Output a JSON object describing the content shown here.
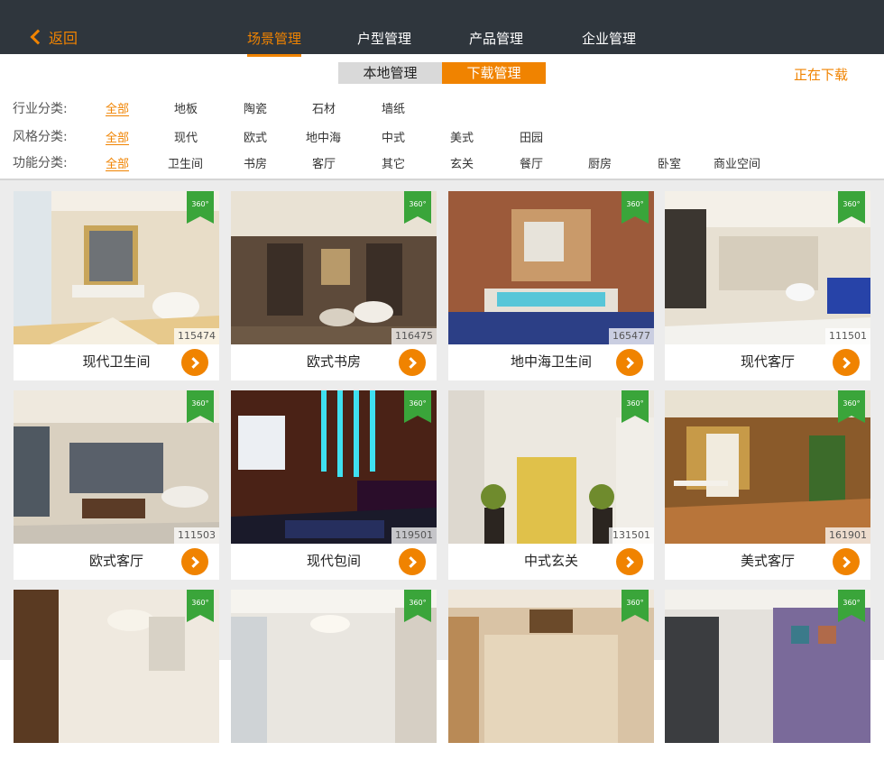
{
  "topbar": {
    "back_label": "返回",
    "tabs": [
      {
        "label": "场景管理",
        "active": true
      },
      {
        "label": "户型管理",
        "active": false
      },
      {
        "label": "产品管理",
        "active": false
      },
      {
        "label": "企业管理",
        "active": false
      }
    ]
  },
  "segment": {
    "local": "本地管理",
    "download": "下载管理",
    "selected": "下载管理"
  },
  "downloading_label": "正在下载",
  "filters": [
    {
      "label": "行业分类:",
      "options": [
        "全部",
        "地板",
        "陶瓷",
        "石材",
        "墙纸"
      ],
      "active": "全部"
    },
    {
      "label": "风格分类:",
      "options": [
        "全部",
        "现代",
        "欧式",
        "地中海",
        "中式",
        "美式",
        "田园"
      ],
      "active": "全部"
    },
    {
      "label": "功能分类:",
      "options": [
        "全部",
        "卫生间",
        "书房",
        "客厅",
        "其它",
        "玄关",
        "餐厅",
        "厨房",
        "卧室",
        "商业空间"
      ],
      "active": "全部"
    }
  ],
  "badge_text": "360°",
  "colors": {
    "accent": "#f08300",
    "topbar": "#2f363d",
    "badge": "#3aa53a"
  },
  "cards": [
    {
      "title": "现代卫生间",
      "num": "115474"
    },
    {
      "title": "欧式书房",
      "num": "116475"
    },
    {
      "title": "地中海卫生间",
      "num": "165477"
    },
    {
      "title": "现代客厅",
      "num": "111501"
    },
    {
      "title": "欧式客厅",
      "num": "111503"
    },
    {
      "title": "现代包间",
      "num": "119501"
    },
    {
      "title": "中式玄关",
      "num": "131501"
    },
    {
      "title": "美式客厅",
      "num": "161901"
    },
    {
      "title": "",
      "num": ""
    },
    {
      "title": "",
      "num": ""
    },
    {
      "title": "",
      "num": ""
    },
    {
      "title": "",
      "num": ""
    }
  ]
}
